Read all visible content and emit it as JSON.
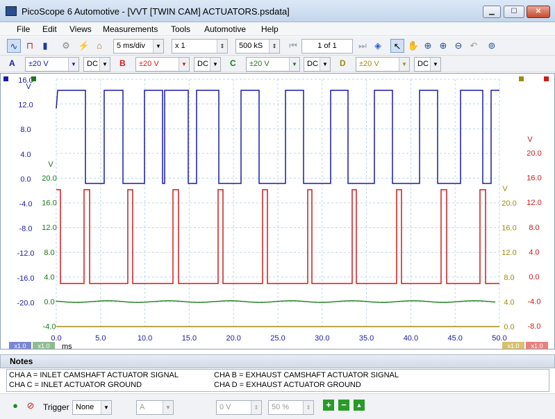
{
  "window": {
    "title": "PicoScope 6 Automotive - [VVT [TWIN CAM] ACTUATORS.psdata]",
    "min_label": "▁",
    "max_label": "☐",
    "close_label": "✕"
  },
  "menu": {
    "items": [
      "File",
      "Edit",
      "Views",
      "Measurements",
      "Tools",
      "Automotive",
      "Help"
    ]
  },
  "toolbar": {
    "timebase": "5 ms/div",
    "zoom": "x 1",
    "samples": "500 kS",
    "buffer": "1 of 1"
  },
  "channels": [
    {
      "letter": "A",
      "range": "±20 V",
      "coupling": "DC",
      "color": "#1a1aa8"
    },
    {
      "letter": "B",
      "range": "±20 V",
      "coupling": "DC",
      "color": "#d01a1a"
    },
    {
      "letter": "C",
      "range": "±20 V",
      "coupling": "DC",
      "color": "#1a7a1a"
    },
    {
      "letter": "D",
      "range": "±20 V",
      "coupling": "DC",
      "color": "#a08a10"
    }
  ],
  "scope": {
    "axisA": {
      "unit": "V",
      "ticks": [
        "16.0",
        "12.0",
        "8.0",
        "4.0",
        "0.0",
        "-4.0",
        "-8.0",
        "-12.0",
        "-16.0",
        "-20.0"
      ]
    },
    "axisC": {
      "unit": "V",
      "ticks": [
        "20.0",
        "16.0",
        "12.0",
        "8.0",
        "4.0",
        "0.0",
        "-4.0"
      ]
    },
    "axisD": {
      "unit": "V",
      "ticks": [
        "20.0",
        "16.0",
        "12.0",
        "8.0",
        "4.0",
        "0.0"
      ]
    },
    "axisB": {
      "unit": "V",
      "ticks": [
        "20.0",
        "16.0",
        "12.0",
        "8.0",
        "4.0",
        "0.0",
        "-4.0",
        "-8.0"
      ]
    },
    "time_ticks": [
      "0.0",
      "5.0",
      "10.0",
      "15.0",
      "20.0",
      "25.0",
      "30.0",
      "35.0",
      "40.0",
      "45.0",
      "50.0"
    ],
    "time_unit": "ms",
    "zoom_tags": [
      "x1.0",
      "x1.0",
      "x1.0",
      "x1.0"
    ]
  },
  "notes": {
    "title": "Notes",
    "lines": [
      "CHA A = INLET CAMSHAFT ACTUATOR SIGNAL",
      "CHA B = EXHAUST CAMSHAFT ACTUATOR SIGNAL",
      "CHA C = INLET ACTUATOR GROUND",
      "CHA D = EXHAUST ACTUATOR GROUND"
    ]
  },
  "statusbar": {
    "trigger_label": "Trigger",
    "trigger_mode": "None",
    "trigger_channel": "A",
    "trigger_level": "0 V",
    "pretrigger": "50 %"
  }
}
